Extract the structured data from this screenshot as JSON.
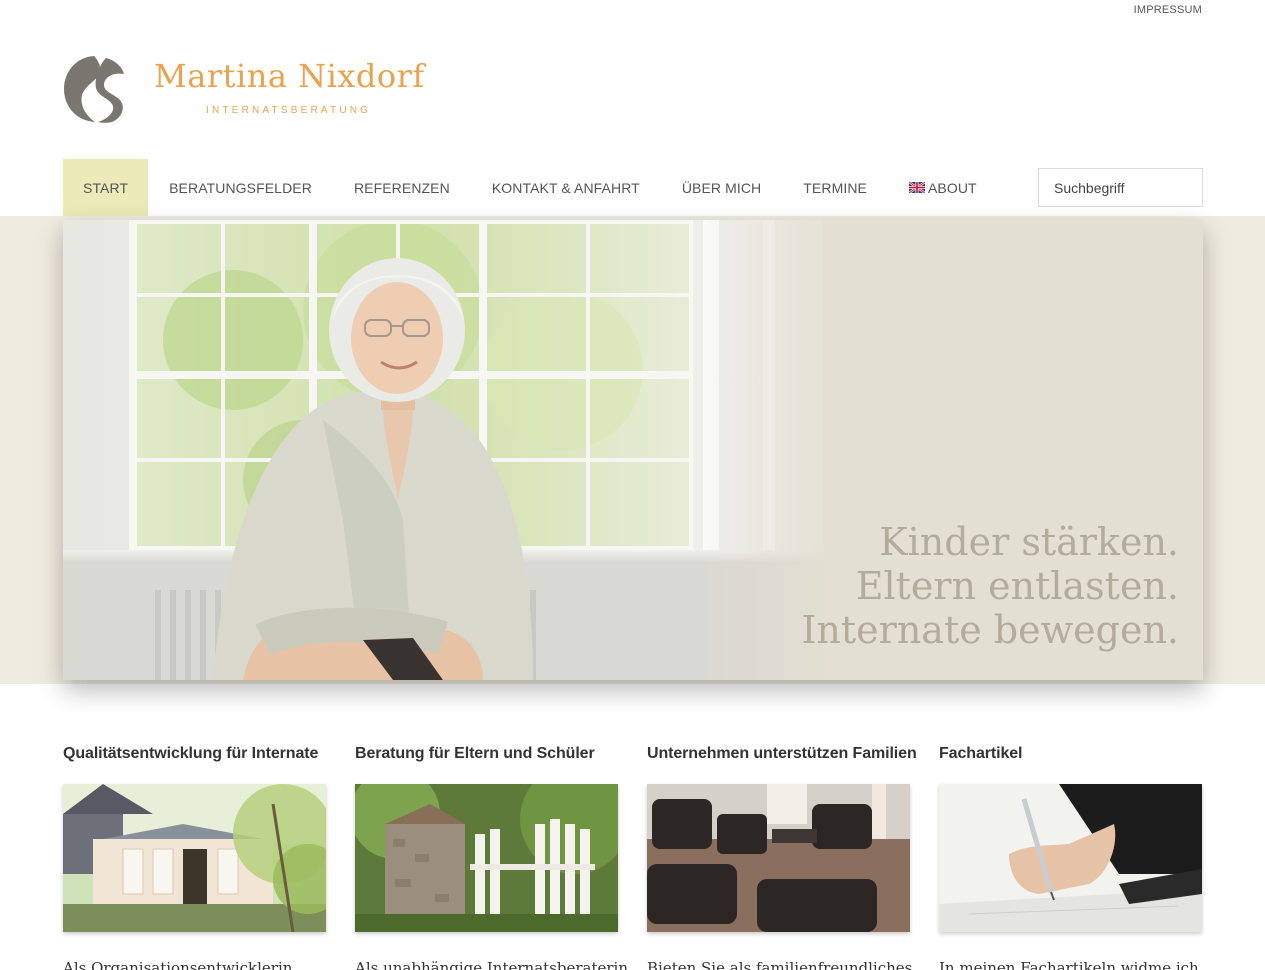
{
  "topbar": {
    "impressum": "IMPRESSUM"
  },
  "brand": {
    "name": "Martina Nixdorf",
    "tagline": "INTERNATSBERATUNG",
    "accent": "#e9a24e",
    "mark_color": "#7a7670"
  },
  "nav": {
    "items": [
      {
        "label": "START",
        "active": true
      },
      {
        "label": "BERATUNGSFELDER"
      },
      {
        "label": "REFERENZEN"
      },
      {
        "label": "KONTAKT & ANFAHRT"
      },
      {
        "label": "ÜBER MICH"
      },
      {
        "label": "TERMINE"
      },
      {
        "label": "ABOUT",
        "icon": "uk-flag-icon"
      }
    ],
    "active_bg": "#ebeab8"
  },
  "search": {
    "placeholder": "Suchbegriff"
  },
  "hero": {
    "lines": [
      "Kinder stärken.",
      "Eltern entlasten.",
      "Internate bewegen."
    ],
    "band_color": "#f0ebe0"
  },
  "features": [
    {
      "title": "Qualitätsentwicklung für Internate",
      "text": "Als Organisationsentwicklerin",
      "image": "house-photo"
    },
    {
      "title": "Beratung für Eltern und Schüler",
      "text": "Als unabhängige Internatsberaterin",
      "image": "garden-gate-photo"
    },
    {
      "title": "Unternehmen unterstützen Familien",
      "text": "Bieten Sie als familienfreundliches",
      "image": "lounge-chairs-photo"
    },
    {
      "title": "Fachartikel",
      "text": "In meinen Fachartikeln widme ich",
      "image": "writing-hand-photo"
    }
  ]
}
